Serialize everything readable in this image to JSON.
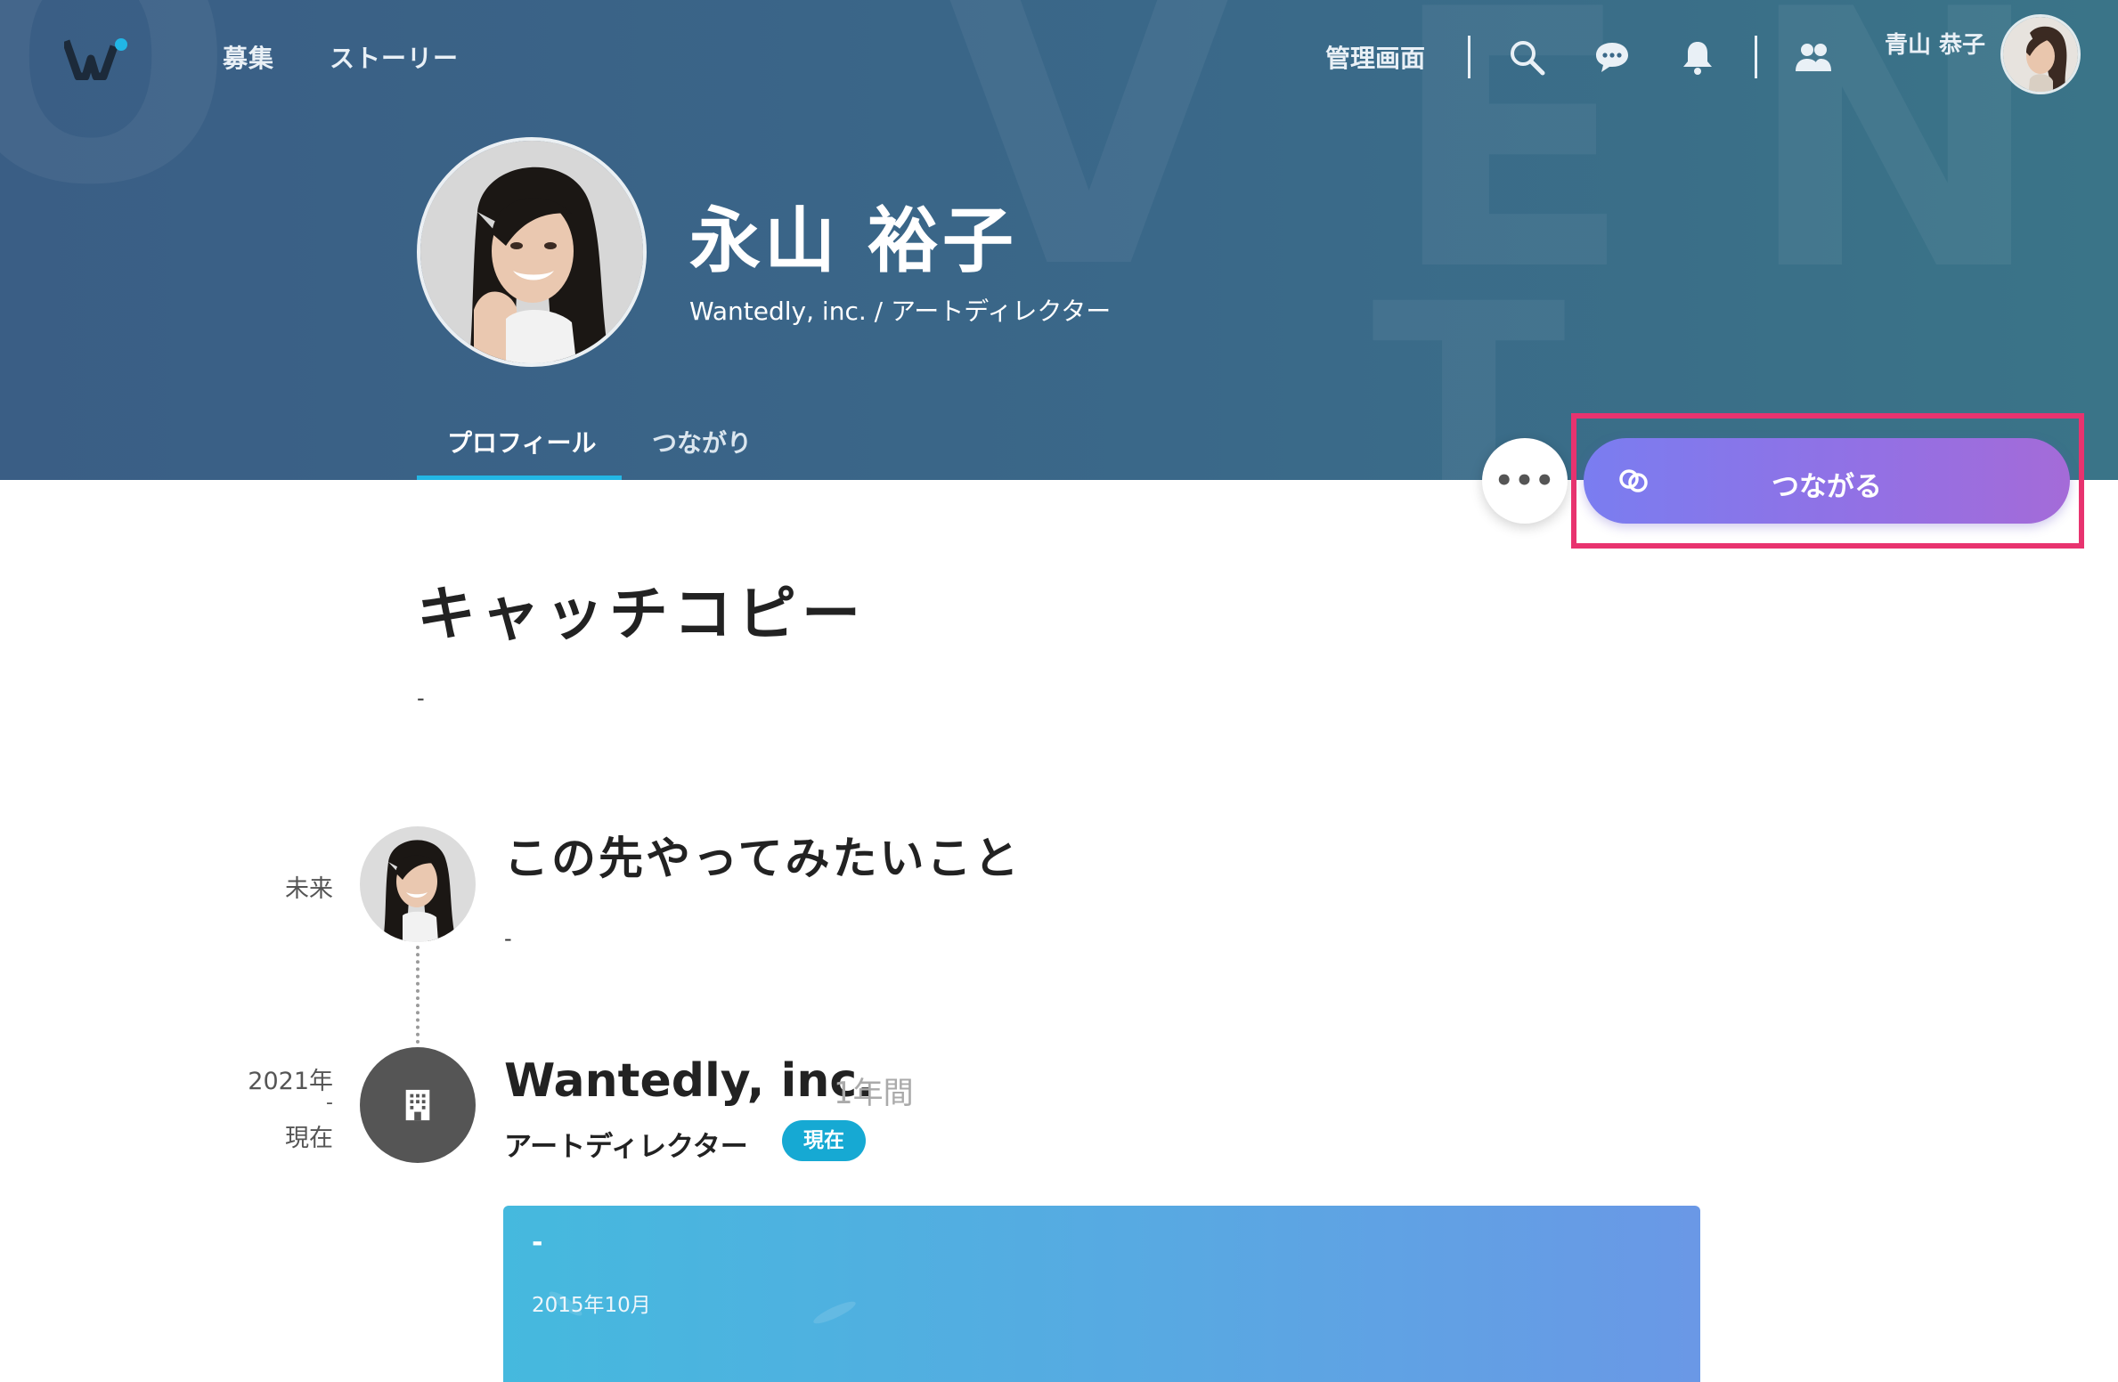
{
  "colors": {
    "hero_bg": "#3a6889",
    "accent_blue": "#23b7e5",
    "connect_gradient_start": "#7a7df0",
    "connect_gradient_end": "#a46bd8",
    "highlight": "#e8336f",
    "badge_bg": "#16a9d3"
  },
  "header": {
    "nav": [
      {
        "label": "募集"
      },
      {
        "label": "ストーリー"
      }
    ],
    "admin_label": "管理画面",
    "icons": [
      "search-icon",
      "chat-icon",
      "bell-icon",
      "people-icon"
    ],
    "user_name": "青山 恭子"
  },
  "profile": {
    "name": "永山 裕子",
    "subtitle": "Wantedly, inc. / アートディレクター",
    "tabs": [
      {
        "label": "プロフィール",
        "active": true
      },
      {
        "label": "つながり",
        "active": false
      }
    ]
  },
  "actions": {
    "more_label": "•••",
    "connect_label": "つながる"
  },
  "catchcopy": {
    "title": "キャッチコピー",
    "text": "-"
  },
  "timeline": {
    "future": {
      "label": "未来",
      "title": "この先やってみたいこと",
      "text": "-"
    },
    "experience": {
      "label_start": "2021年",
      "label_sep": "-",
      "label_end": "現在",
      "company": "Wantedly, inc.",
      "duration": "1年間",
      "role": "アートディレクター",
      "badge": "現在"
    },
    "story_card": {
      "title": "-",
      "date": "2015年10月"
    }
  }
}
